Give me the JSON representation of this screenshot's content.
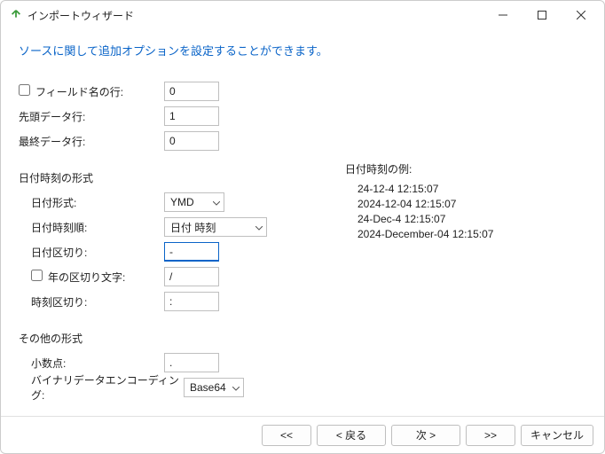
{
  "window": {
    "title": "インポートウィザード"
  },
  "heading": "ソースに関して追加オプションを設定することができます。",
  "fields": {
    "fieldNameRow": {
      "label": "フィールド名の行:",
      "value": "0"
    },
    "firstDataRow": {
      "label": "先頭データ行:",
      "value": "1"
    },
    "lastDataRow": {
      "label": "最終データ行:",
      "value": "0"
    }
  },
  "datetimeSection": "日付時刻の形式",
  "datetime": {
    "format": {
      "label": "日付形式:",
      "value": "YMD"
    },
    "order": {
      "label": "日付時刻順:",
      "value": "日付 時刻"
    },
    "dateSep": {
      "label": "日付区切り:",
      "value": "-"
    },
    "fourDigitYear": {
      "label": "年の区切り文字:",
      "value": "/"
    },
    "timeSep": {
      "label": "時刻区切り:",
      "value": ":"
    }
  },
  "examplesHeader": "日付時刻の例:",
  "examples": [
    "24-12-4 12:15:07",
    "2024-12-04 12:15:07",
    "24-Dec-4 12:15:07",
    "2024-December-04 12:15:07"
  ],
  "otherSection": "その他の形式",
  "other": {
    "decimal": {
      "label": "小数点:",
      "value": "."
    },
    "encoding": {
      "label": "バイナリデータエンコーディング:",
      "value": "Base64"
    }
  },
  "buttons": {
    "first": "<<",
    "back": "< 戻る",
    "next": "次 >",
    "last": ">>",
    "cancel": "キャンセル"
  }
}
